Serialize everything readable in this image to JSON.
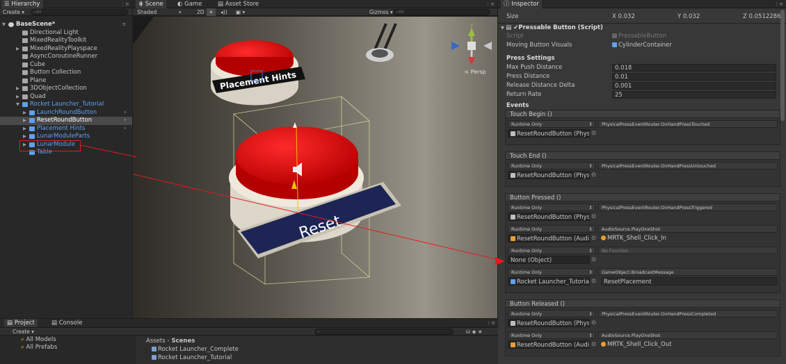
{
  "hierarchy": {
    "tab": "Hierarchy",
    "create_label": "Create",
    "search_placeholder": "All",
    "items": [
      {
        "label": "BaseScene*",
        "depth": 0,
        "expanded": true,
        "bold": true
      },
      {
        "label": "Directional Light",
        "depth": 1
      },
      {
        "label": "MixedRealityToolkit",
        "depth": 1
      },
      {
        "label": "MixedRealityPlayspace",
        "depth": 1,
        "collapsed": true
      },
      {
        "label": "AsyncCoroutineRunner",
        "depth": 1
      },
      {
        "label": "Cube",
        "depth": 1
      },
      {
        "label": "Button Collection",
        "depth": 1
      },
      {
        "label": "Plane",
        "depth": 1
      },
      {
        "label": "3DObjectCollection",
        "depth": 1,
        "collapsed": true
      },
      {
        "label": "Quad",
        "depth": 1,
        "collapsed": true
      },
      {
        "label": "Rocket Launcher_Tutorial",
        "depth": 1,
        "expanded": true,
        "prefab": true
      },
      {
        "label": "LaunchRoundButton",
        "depth": 2,
        "collapsed": true,
        "prefab": true
      },
      {
        "label": "ResetRoundButton",
        "depth": 2,
        "collapsed": true,
        "prefab": true,
        "selected": true
      },
      {
        "label": "Placement Hints",
        "depth": 2,
        "collapsed": true,
        "prefab": true
      },
      {
        "label": "LunarModuleParts",
        "depth": 2,
        "collapsed": true,
        "prefab": true
      },
      {
        "label": "LunarModule",
        "depth": 2,
        "collapsed": true,
        "prefab": true,
        "highlighted": true
      },
      {
        "label": "Table",
        "depth": 2,
        "prefab": true
      }
    ]
  },
  "scene": {
    "tabs": [
      "Scene",
      "Game",
      "Asset Store"
    ],
    "shading": "Shaded",
    "mode_2d": "2D",
    "gizmos_label": "Gizmos",
    "search_placeholder": "All",
    "persp_label": "< Persp",
    "gizmo_axis": "y",
    "placement_hints_label": "Placement Hints",
    "reset_label": "Reset"
  },
  "project": {
    "tabs": [
      "Project",
      "Console"
    ],
    "create_label": "Create",
    "favorites": [
      "All Models",
      "All Prefabs"
    ],
    "breadcrumb": [
      "Assets",
      "Scenes"
    ],
    "assets": [
      "Rocket Launcher_Complete",
      "Rocket Launcher_Tutorial"
    ]
  },
  "inspector": {
    "tab": "Inspector",
    "size_label": "Size",
    "size_x": "X 0.032",
    "size_y": "Y 0.032",
    "size_z": "Z 0.0512286",
    "component_title": "Pressable Button (Script)",
    "script_label": "Script",
    "script_value": "PressableButton",
    "moving_label": "Moving Button Visuals",
    "moving_value": "CylinderContainer",
    "press_settings": "Press Settings",
    "fields": [
      {
        "label": "Max Push Distance",
        "value": "0.018"
      },
      {
        "label": "Press Distance",
        "value": "0.01"
      },
      {
        "label": "Release Distance Delta",
        "value": "0.001"
      },
      {
        "label": "Return Rate",
        "value": "25"
      }
    ],
    "events_label": "Events",
    "events": [
      {
        "title": "Touch Begin ()",
        "entries": [
          {
            "runtime": "Runtime Only",
            "function": "PhysicalPressEventRouter.OnHandPressTouched",
            "object": "ResetRoundButton (Physica"
          }
        ]
      },
      {
        "title": "Touch End ()",
        "entries": [
          {
            "runtime": "Runtime Only",
            "function": "PhysicalPressEventRouter.OnHandPressUntouched",
            "object": "ResetRoundButton (Physica"
          }
        ]
      },
      {
        "title": "Button Pressed ()",
        "entries": [
          {
            "runtime": "Runtime Only",
            "function": "PhysicalPressEventRouter.OnHandPressTriggered",
            "object": "ResetRoundButton (Physica"
          },
          {
            "runtime": "Runtime Only",
            "function": "AudioSource.PlayOneShot",
            "object": "ResetRoundButton (Audio S",
            "arg": "MRTK_Shell_Click_In"
          },
          {
            "runtime": "Runtime Only",
            "function": "No Function",
            "object": "None (Object)"
          },
          {
            "runtime": "Runtime Only",
            "function": "GameObject.BroadcastMessage",
            "object": "Rocket Launcher_Tutorial",
            "arg": "ResetPlacement"
          }
        ]
      },
      {
        "title": "Button Released ()",
        "entries": [
          {
            "runtime": "Runtime Only",
            "function": "PhysicalPressEventRouter.OnHandPressCompleted",
            "object": "ResetRoundButton (Physica"
          },
          {
            "runtime": "Runtime Only",
            "function": "AudioSource.PlayOneShot",
            "object": "ResetRoundButton (Audio S",
            "arg": "MRTK_Shell_Click_Out"
          }
        ]
      }
    ]
  },
  "colors": {
    "accent": "#3d6da8",
    "annotation": "#e21b1b",
    "prefab": "#5fa0f0",
    "button_red": "#e01010",
    "reset_plate": "#1c2554"
  }
}
